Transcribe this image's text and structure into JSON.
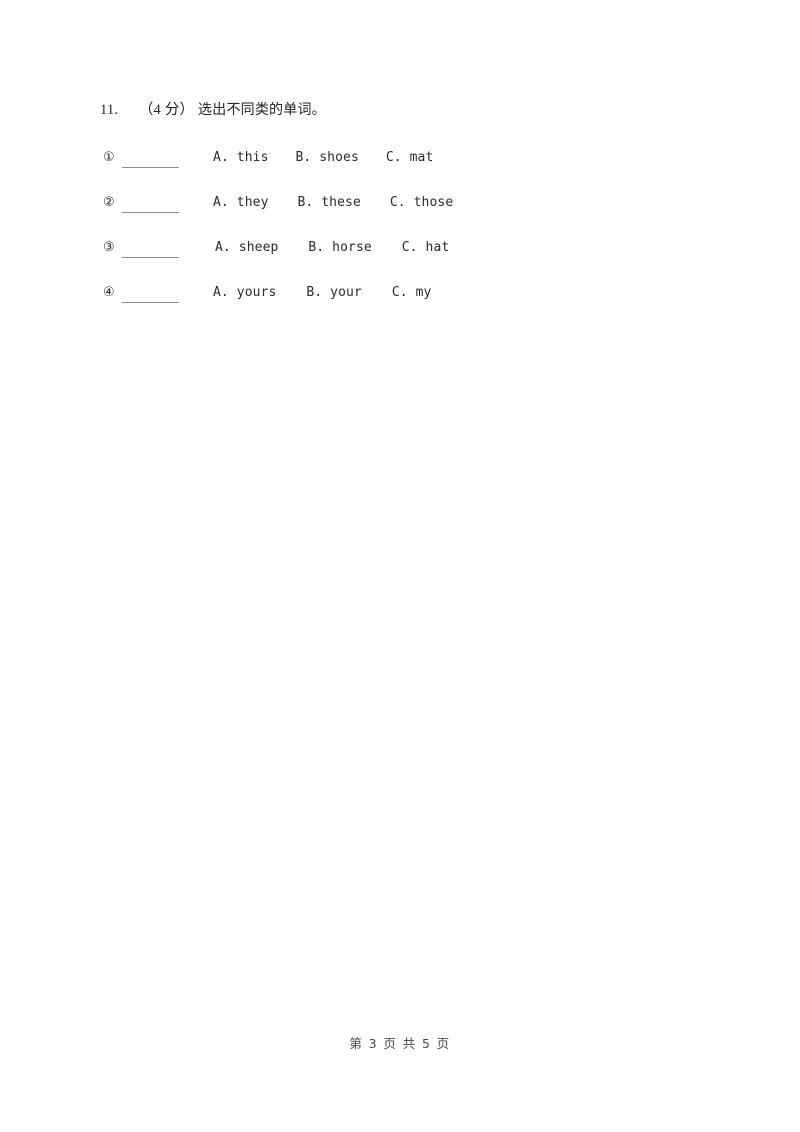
{
  "document": {
    "background_color": "#ffffff",
    "text_color": "#252525",
    "rule_color": "#8d8d8d"
  },
  "question": {
    "number": "11.",
    "score": "（4 分）",
    "prompt": "选出不同类的单词。",
    "full_heading": "11.　（4 分）选出不同类的单词。",
    "items": [
      {
        "marker": "①",
        "blank": "",
        "options": [
          {
            "letter": "A.",
            "word": "this"
          },
          {
            "letter": "B.",
            "word": "shoes"
          },
          {
            "letter": "C.",
            "word": "mat"
          }
        ]
      },
      {
        "marker": "②",
        "blank": "",
        "options": [
          {
            "letter": "A.",
            "word": "they"
          },
          {
            "letter": "B.",
            "word": "these"
          },
          {
            "letter": "C.",
            "word": "those"
          }
        ]
      },
      {
        "marker": "③",
        "blank": "",
        "options": [
          {
            "letter": "A.",
            "word": "sheep"
          },
          {
            "letter": "B.",
            "word": "horse"
          },
          {
            "letter": "C.",
            "word": "hat"
          }
        ]
      },
      {
        "marker": "④",
        "blank": "",
        "options": [
          {
            "letter": "A.",
            "word": "yours"
          },
          {
            "letter": "B.",
            "word": "your"
          },
          {
            "letter": "C.",
            "word": "my"
          }
        ]
      }
    ]
  },
  "footer": {
    "text": "第 3 页 共 5 页",
    "current_page": "3",
    "total_pages": "5"
  }
}
